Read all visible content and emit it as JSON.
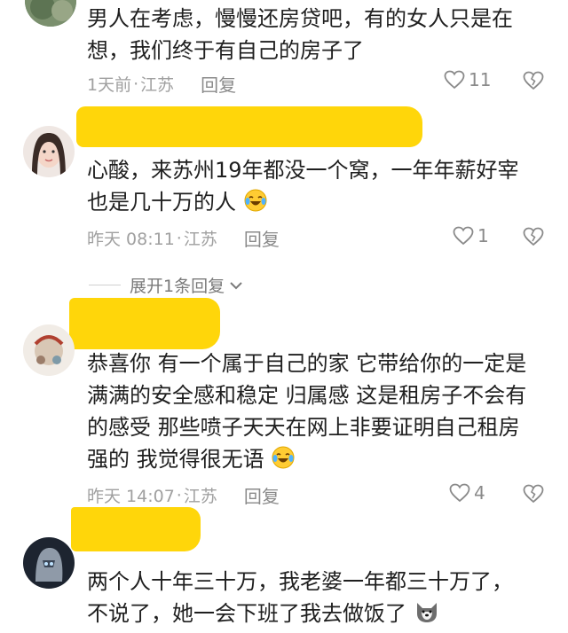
{
  "comments": [
    {
      "author": "",
      "text_lines": [
        "男人在考虑，慢慢还房贷吧，有的女人只是在",
        "想，我们终于有自己的房子了"
      ],
      "time": "1天前",
      "location": "江苏",
      "reply_label": "回复",
      "likes": "11"
    },
    {
      "author": "",
      "text_lines": [
        "心酸，来苏州19年都没一个窝，一年年薪好宰",
        "也是几十万的人"
      ],
      "time": "昨天 08:11",
      "location": "江苏",
      "reply_label": "回复",
      "likes": "1"
    },
    {
      "author": "",
      "text_lines": [
        "恭喜你 有一个属于自己的家 它带给你的一定是",
        "满满的安全感和稳定 归属感 这是租房子不会有",
        "的感受 那些喷子天天在网上非要证明自己租房",
        "强的 我觉得很无语"
      ],
      "time": "昨天 14:07",
      "location": "江苏",
      "reply_label": "回复",
      "likes": "4"
    },
    {
      "author": "",
      "text_lines": [
        "两个人十年三十万，我老婆一年都三十万了，",
        "不说了，她一会下班了我去做饭了"
      ]
    }
  ],
  "expand_replies": "展开1条回复",
  "separator": "·",
  "colors": {
    "highlight": "#ffd400",
    "emoji_face": "#ffcc33",
    "meta_text": "#a0a0a0"
  },
  "icons": [
    "heart-icon",
    "broken-heart-icon",
    "chevron-down-icon",
    "laugh-cry-emoji",
    "dog-emoji"
  ]
}
